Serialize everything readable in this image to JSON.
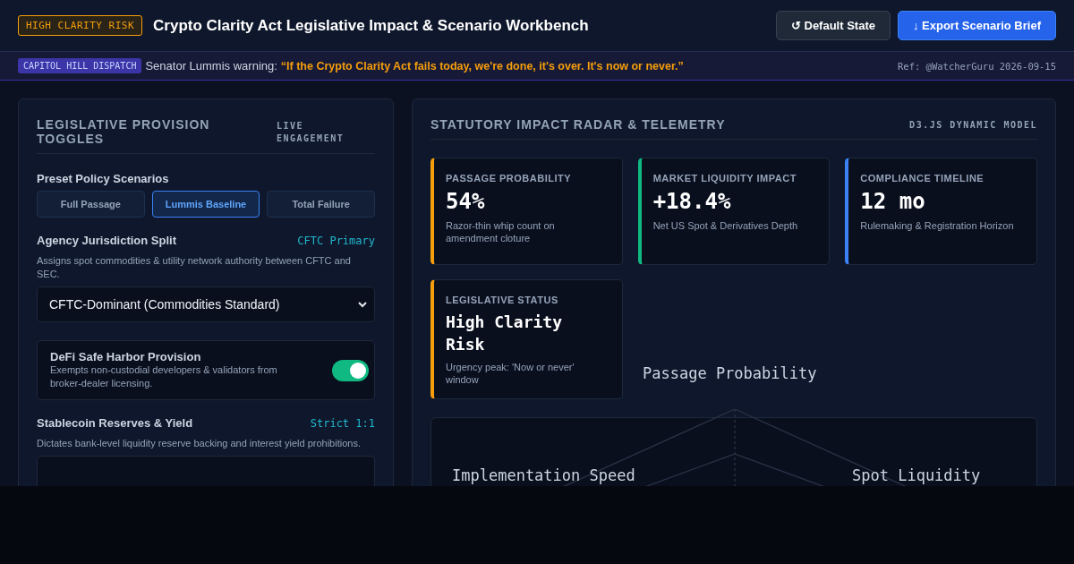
{
  "header": {
    "badge": "HIGH CLARITY RISK",
    "title": "Crypto Clarity Act Legislative Impact & Scenario Workbench",
    "buttons": [
      {
        "label": "↺ Default State",
        "kind": "secondary"
      },
      {
        "label": "↓ Export Scenario Brief",
        "kind": "primary"
      }
    ]
  },
  "dispatch": {
    "tag": "CAPITOL HILL DISPATCH",
    "lead": "Senator Lummis warning:",
    "quote": "“If the Crypto Clarity Act fails today, we're done, it's over. It's now or never.”",
    "ref": "Ref: @WatcherGuru 2026-09-15"
  },
  "provisions": {
    "title": "LEGISLATIVE PROVISION TOGGLES",
    "tag": "LIVE ENGAGEMENT",
    "presets_label": "Preset Policy Scenarios",
    "presets": [
      {
        "label": "Full Passage",
        "selected": false
      },
      {
        "label": "Lummis Baseline",
        "selected": true
      },
      {
        "label": "Total Failure",
        "selected": false
      }
    ],
    "jurisdiction": {
      "label": "Agency Jurisdiction Split",
      "value": "CFTC Primary",
      "description": "Assigns spot commodities & utility network authority between CFTC and SEC.",
      "select": "CFTC-Dominant (Commodities Standard)"
    },
    "safe_harbor": {
      "label": "DeFi Safe Harbor Provision",
      "description": "Exempts non-custodial developers & validators from broker-dealer licensing.",
      "on": true
    },
    "stablecoin": {
      "label": "Stablecoin Reserves & Yield",
      "value": "Strict 1:1",
      "description": "Dictates bank-level liquidity reserve backing and interest yield prohibitions."
    }
  },
  "telemetry": {
    "title": "STATUTORY IMPACT RADAR & TELEMETRY",
    "tag": "D3.JS DYNAMIC MODEL",
    "metrics": [
      {
        "label": "PASSAGE PROBABILITY",
        "value": "54%",
        "note": "Razor-thin whip count on amendment cloture",
        "color": "#f59e0b"
      },
      {
        "label": "MARKET LIQUIDITY IMPACT",
        "value": "+18.4%",
        "note": "Net US Spot & Derivatives Depth",
        "color": "#10b981"
      },
      {
        "label": "COMPLIANCE TIMELINE",
        "value": "12 mo",
        "note": "Rulemaking & Registration Horizon",
        "color": "#3b82f6"
      },
      {
        "label": "LEGISLATIVE STATUS",
        "value": "High Clarity Risk",
        "note": "Urgency peak: 'Now or never' window",
        "color": "#f59e0b"
      }
    ],
    "radar_axes": [
      "Passage Probability",
      "Implementation Speed",
      "Spot Liquidity"
    ]
  }
}
